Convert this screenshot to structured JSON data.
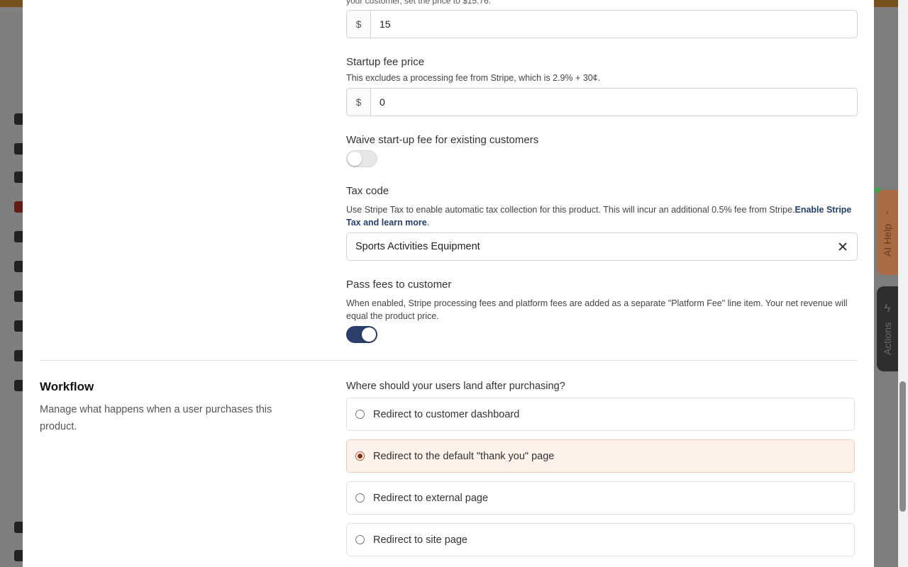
{
  "background": {
    "side_tabs": {
      "ai_help_label": "AI Help",
      "actions_label": "Actions"
    }
  },
  "pricing": {
    "truncated_note": "your customer, set the price to $15.76.",
    "price": {
      "currency_symbol": "$",
      "value": "15"
    },
    "startup_fee": {
      "label": "Startup fee price",
      "help": "This excludes a processing fee from Stripe, which is 2.9% + 30¢.",
      "currency_symbol": "$",
      "value": "0"
    },
    "waive_startup": {
      "label": "Waive start-up fee for existing customers",
      "enabled": false
    },
    "tax_code": {
      "label": "Tax code",
      "help": "Use Stripe Tax to enable automatic tax collection for this product. This will incur an additional 0.5% fee from Stripe.",
      "help_link": "Enable Stripe Tax and learn more",
      "help_suffix": ".",
      "value": "Sports Activities Equipment"
    },
    "pass_fees": {
      "label": "Pass fees to customer",
      "help": "When enabled, Stripe processing fees and platform fees are added as a separate \"Platform Fee\" line item. Your net revenue will equal the product price.",
      "enabled": true
    }
  },
  "workflow": {
    "title": "Workflow",
    "description": "Manage what happens when a user purchases this product.",
    "question": "Where should your users land after purchasing?",
    "options": [
      {
        "label": "Redirect to customer dashboard",
        "selected": false
      },
      {
        "label": "Redirect to the default \"thank you\" page",
        "selected": true
      },
      {
        "label": "Redirect to external page",
        "selected": false
      },
      {
        "label": "Redirect to site page",
        "selected": false
      }
    ]
  },
  "colors": {
    "toggle_on": "#2c3f6b",
    "selected_option_bg": "#fdf1ec",
    "link": "#27406b"
  }
}
